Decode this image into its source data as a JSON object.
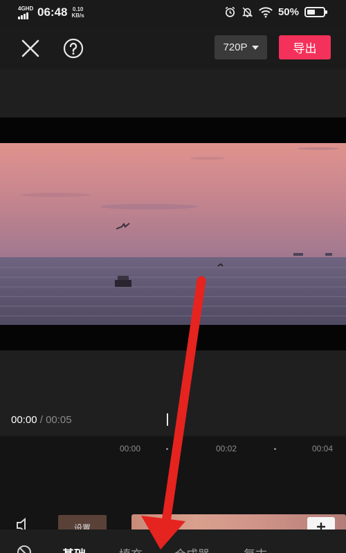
{
  "status_bar": {
    "network": "4GHD",
    "time": "06:48",
    "speed_value": "0.10",
    "speed_unit": "KB/s",
    "battery_percent": "50%",
    "battery_level": 0.5,
    "icons": [
      "alarm-icon",
      "mute-bell-icon",
      "wifi-icon",
      "battery-icon"
    ]
  },
  "top_bar": {
    "close_icon": "close-icon",
    "help_icon": "help-icon",
    "resolution": "720P",
    "export_label": "导出",
    "accent_color": "#f4315a"
  },
  "player": {
    "current_time": "00:00",
    "separator": "/",
    "total_time": "00:05"
  },
  "timeline": {
    "ruler_labels": [
      "00:00",
      "00:02",
      "00:04"
    ],
    "cover_label": "设置"
  },
  "bottom_tabs": [
    {
      "label": "基础",
      "active": true
    },
    {
      "label": "填充",
      "active": false
    },
    {
      "label": "合成器",
      "active": false
    },
    {
      "label": "复古",
      "active": false
    }
  ]
}
